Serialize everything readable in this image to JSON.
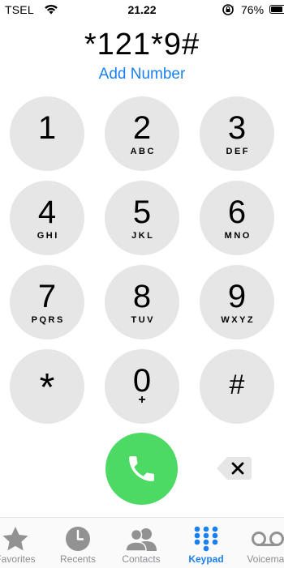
{
  "status_bar": {
    "carrier": "TSEL",
    "time": "21.22",
    "battery_percent": "76%",
    "battery_level": 0.76,
    "icons": [
      "wifi-icon",
      "rotation-lock-icon",
      "battery-icon"
    ]
  },
  "dialer": {
    "dialed_number": "*121*9#",
    "add_number_label": "Add Number",
    "accent_color": "#1a80f0"
  },
  "keys": [
    {
      "digit": "1",
      "letters": ""
    },
    {
      "digit": "2",
      "letters": "ABC"
    },
    {
      "digit": "3",
      "letters": "DEF"
    },
    {
      "digit": "4",
      "letters": "GHI"
    },
    {
      "digit": "5",
      "letters": "JKL"
    },
    {
      "digit": "6",
      "letters": "MNO"
    },
    {
      "digit": "7",
      "letters": "PQRS"
    },
    {
      "digit": "8",
      "letters": "TUV"
    },
    {
      "digit": "9",
      "letters": "WXYZ"
    },
    {
      "digit": "*",
      "letters": ""
    },
    {
      "digit": "0",
      "letters": "+"
    },
    {
      "digit": "#",
      "letters": ""
    }
  ],
  "actions": {
    "call_icon": "phone-icon",
    "call_color": "#4cd964",
    "delete_icon": "backspace-icon"
  },
  "tab_bar": {
    "tabs": [
      {
        "label": "Favorites",
        "icon": "star-icon",
        "active": false
      },
      {
        "label": "Recents",
        "icon": "clock-icon",
        "active": false
      },
      {
        "label": "Contacts",
        "icon": "contacts-icon",
        "active": false
      },
      {
        "label": "Keypad",
        "icon": "keypad-icon",
        "active": true
      },
      {
        "label": "Voicemail",
        "icon": "voicemail-icon",
        "active": false
      }
    ]
  }
}
